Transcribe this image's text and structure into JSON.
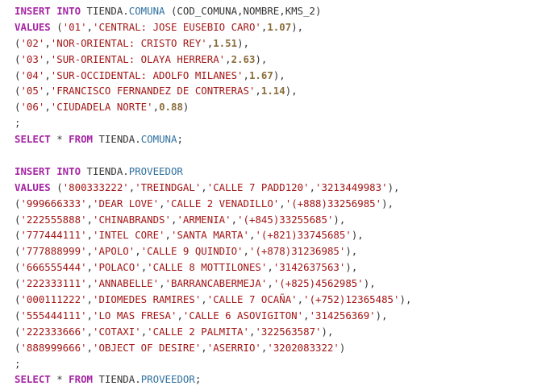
{
  "editor": {
    "language": "SQL",
    "lines": [
      [
        {
          "t": "kw",
          "v": "INSERT INTO"
        },
        {
          "t": "plain",
          "v": " TIENDA."
        },
        {
          "t": "table",
          "v": "COMUNA"
        },
        {
          "t": "plain",
          "v": " (COD_COMUNA,NOMBRE,KMS_2)"
        }
      ],
      [
        {
          "t": "kw",
          "v": "VALUES"
        },
        {
          "t": "plain",
          "v": " ("
        },
        {
          "t": "str",
          "v": "'01'"
        },
        {
          "t": "plain",
          "v": ","
        },
        {
          "t": "str",
          "v": "'CENTRAL: JOSE EUSEBIO CARO'"
        },
        {
          "t": "plain",
          "v": ","
        },
        {
          "t": "num",
          "v": "1.07"
        },
        {
          "t": "plain",
          "v": "),"
        }
      ],
      [
        {
          "t": "plain",
          "v": "("
        },
        {
          "t": "str",
          "v": "'02'"
        },
        {
          "t": "plain",
          "v": ","
        },
        {
          "t": "str",
          "v": "'NOR-ORIENTAL: CRISTO REY'"
        },
        {
          "t": "plain",
          "v": ","
        },
        {
          "t": "num",
          "v": "1.51"
        },
        {
          "t": "plain",
          "v": "),"
        }
      ],
      [
        {
          "t": "plain",
          "v": "("
        },
        {
          "t": "str",
          "v": "'03'"
        },
        {
          "t": "plain",
          "v": ","
        },
        {
          "t": "str",
          "v": "'SUR-ORIENTAL: OLAYA HERRERA'"
        },
        {
          "t": "plain",
          "v": ","
        },
        {
          "t": "num",
          "v": "2.63"
        },
        {
          "t": "plain",
          "v": "),"
        }
      ],
      [
        {
          "t": "plain",
          "v": "("
        },
        {
          "t": "str",
          "v": "'04'"
        },
        {
          "t": "plain",
          "v": ","
        },
        {
          "t": "str",
          "v": "'SUR-OCCIDENTAL: ADOLFO MILANES'"
        },
        {
          "t": "plain",
          "v": ","
        },
        {
          "t": "num",
          "v": "1.67"
        },
        {
          "t": "plain",
          "v": "),"
        }
      ],
      [
        {
          "t": "plain",
          "v": "("
        },
        {
          "t": "str",
          "v": "'05'"
        },
        {
          "t": "plain",
          "v": ","
        },
        {
          "t": "str",
          "v": "'FRANCISCO FERNANDEZ DE CONTRERAS'"
        },
        {
          "t": "plain",
          "v": ","
        },
        {
          "t": "num",
          "v": "1.14"
        },
        {
          "t": "plain",
          "v": "),"
        }
      ],
      [
        {
          "t": "plain",
          "v": "("
        },
        {
          "t": "str",
          "v": "'06'"
        },
        {
          "t": "plain",
          "v": ","
        },
        {
          "t": "str",
          "v": "'CIUDADELA NORTE'"
        },
        {
          "t": "plain",
          "v": ","
        },
        {
          "t": "num",
          "v": "0.88"
        },
        {
          "t": "plain",
          "v": ")"
        }
      ],
      [
        {
          "t": "plain",
          "v": ";"
        }
      ],
      [
        {
          "t": "kw",
          "v": "SELECT"
        },
        {
          "t": "plain",
          "v": " * "
        },
        {
          "t": "kw",
          "v": "FROM"
        },
        {
          "t": "plain",
          "v": " TIENDA."
        },
        {
          "t": "table",
          "v": "COMUNA"
        },
        {
          "t": "plain",
          "v": ";"
        }
      ],
      [],
      [
        {
          "t": "kw",
          "v": "INSERT INTO"
        },
        {
          "t": "plain",
          "v": " TIENDA."
        },
        {
          "t": "table",
          "v": "PROVEEDOR"
        }
      ],
      [
        {
          "t": "kw",
          "v": "VALUES"
        },
        {
          "t": "plain",
          "v": " ("
        },
        {
          "t": "str",
          "v": "'800333222'"
        },
        {
          "t": "plain",
          "v": ","
        },
        {
          "t": "str",
          "v": "'TREINDGAL'"
        },
        {
          "t": "plain",
          "v": ","
        },
        {
          "t": "str",
          "v": "'CALLE 7 PADD120'"
        },
        {
          "t": "plain",
          "v": ","
        },
        {
          "t": "str",
          "v": "'3213449983'"
        },
        {
          "t": "plain",
          "v": "),"
        }
      ],
      [
        {
          "t": "plain",
          "v": "("
        },
        {
          "t": "str",
          "v": "'999666333'"
        },
        {
          "t": "plain",
          "v": ","
        },
        {
          "t": "str",
          "v": "'DEAR LOVE'"
        },
        {
          "t": "plain",
          "v": ","
        },
        {
          "t": "str",
          "v": "'CALLE 2 VENADILLO'"
        },
        {
          "t": "plain",
          "v": ","
        },
        {
          "t": "str",
          "v": "'(+888)33256985'"
        },
        {
          "t": "plain",
          "v": "),"
        }
      ],
      [
        {
          "t": "plain",
          "v": "("
        },
        {
          "t": "str",
          "v": "'222555888'"
        },
        {
          "t": "plain",
          "v": ","
        },
        {
          "t": "str",
          "v": "'CHINABRANDS'"
        },
        {
          "t": "plain",
          "v": ","
        },
        {
          "t": "str",
          "v": "'ARMENIA'"
        },
        {
          "t": "plain",
          "v": ","
        },
        {
          "t": "str",
          "v": "'(+845)33255685'"
        },
        {
          "t": "plain",
          "v": "),"
        }
      ],
      [
        {
          "t": "plain",
          "v": "("
        },
        {
          "t": "str",
          "v": "'777444111'"
        },
        {
          "t": "plain",
          "v": ","
        },
        {
          "t": "str",
          "v": "'INTEL CORE'"
        },
        {
          "t": "plain",
          "v": ","
        },
        {
          "t": "str",
          "v": "'SANTA MARTA'"
        },
        {
          "t": "plain",
          "v": ","
        },
        {
          "t": "str",
          "v": "'(+821)33745685'"
        },
        {
          "t": "plain",
          "v": "),"
        }
      ],
      [
        {
          "t": "plain",
          "v": "("
        },
        {
          "t": "str",
          "v": "'777888999'"
        },
        {
          "t": "plain",
          "v": ","
        },
        {
          "t": "str",
          "v": "'APOLO'"
        },
        {
          "t": "plain",
          "v": ","
        },
        {
          "t": "str",
          "v": "'CALLE 9 QUINDIO'"
        },
        {
          "t": "plain",
          "v": ","
        },
        {
          "t": "str",
          "v": "'(+878)31236985'"
        },
        {
          "t": "plain",
          "v": "),"
        }
      ],
      [
        {
          "t": "plain",
          "v": "("
        },
        {
          "t": "str",
          "v": "'666555444'"
        },
        {
          "t": "plain",
          "v": ","
        },
        {
          "t": "str",
          "v": "'POLACO'"
        },
        {
          "t": "plain",
          "v": ","
        },
        {
          "t": "str",
          "v": "'CALLE 8 MOTTILONES'"
        },
        {
          "t": "plain",
          "v": ","
        },
        {
          "t": "str",
          "v": "'3142637563'"
        },
        {
          "t": "plain",
          "v": "),"
        }
      ],
      [
        {
          "t": "plain",
          "v": "("
        },
        {
          "t": "str",
          "v": "'222333111'"
        },
        {
          "t": "plain",
          "v": ","
        },
        {
          "t": "str",
          "v": "'ANNABELLE'"
        },
        {
          "t": "plain",
          "v": ","
        },
        {
          "t": "str",
          "v": "'BARRANCABERMEJA'"
        },
        {
          "t": "plain",
          "v": ","
        },
        {
          "t": "str",
          "v": "'(+825)4562985'"
        },
        {
          "t": "plain",
          "v": "),"
        }
      ],
      [
        {
          "t": "plain",
          "v": "("
        },
        {
          "t": "str",
          "v": "'000111222'"
        },
        {
          "t": "plain",
          "v": ","
        },
        {
          "t": "str",
          "v": "'DIOMEDES RAMIRES'"
        },
        {
          "t": "plain",
          "v": ","
        },
        {
          "t": "str",
          "v": "'CALLE 7 OCAÑA'"
        },
        {
          "t": "plain",
          "v": ","
        },
        {
          "t": "str",
          "v": "'(+752)12365485'"
        },
        {
          "t": "plain",
          "v": "),"
        }
      ],
      [
        {
          "t": "plain",
          "v": "("
        },
        {
          "t": "str",
          "v": "'555444111'"
        },
        {
          "t": "plain",
          "v": ","
        },
        {
          "t": "str",
          "v": "'LO MAS FRESA'"
        },
        {
          "t": "plain",
          "v": ","
        },
        {
          "t": "str",
          "v": "'CALLE 6 ASOVIGITON'"
        },
        {
          "t": "plain",
          "v": ","
        },
        {
          "t": "str",
          "v": "'314256369'"
        },
        {
          "t": "plain",
          "v": "),"
        }
      ],
      [
        {
          "t": "plain",
          "v": "("
        },
        {
          "t": "str",
          "v": "'222333666'"
        },
        {
          "t": "plain",
          "v": ","
        },
        {
          "t": "str",
          "v": "'COTAXI'"
        },
        {
          "t": "plain",
          "v": ","
        },
        {
          "t": "str",
          "v": "'CALLE 2 PALMITA'"
        },
        {
          "t": "plain",
          "v": ","
        },
        {
          "t": "str",
          "v": "'322563587'"
        },
        {
          "t": "plain",
          "v": "),"
        }
      ],
      [
        {
          "t": "plain",
          "v": "("
        },
        {
          "t": "str",
          "v": "'888999666'"
        },
        {
          "t": "plain",
          "v": ","
        },
        {
          "t": "str",
          "v": "'OBJECT OF DESIRE'"
        },
        {
          "t": "plain",
          "v": ","
        },
        {
          "t": "str",
          "v": "'ASERRIO'"
        },
        {
          "t": "plain",
          "v": ","
        },
        {
          "t": "str",
          "v": "'3202083322'"
        },
        {
          "t": "plain",
          "v": ")"
        }
      ],
      [
        {
          "t": "plain",
          "v": ";"
        }
      ],
      [
        {
          "t": "kw",
          "v": "SELECT"
        },
        {
          "t": "plain",
          "v": " * "
        },
        {
          "t": "kw",
          "v": "FROM"
        },
        {
          "t": "plain",
          "v": " TIENDA."
        },
        {
          "t": "table",
          "v": "PROVEEDOR"
        },
        {
          "t": "plain",
          "v": ";"
        }
      ]
    ]
  },
  "colors": {
    "keyword": "#a626a4",
    "string": "#a31515",
    "number": "#8a6d3b",
    "table": "#2f6f9f",
    "text": "#333333",
    "background": "#ffffff"
  }
}
